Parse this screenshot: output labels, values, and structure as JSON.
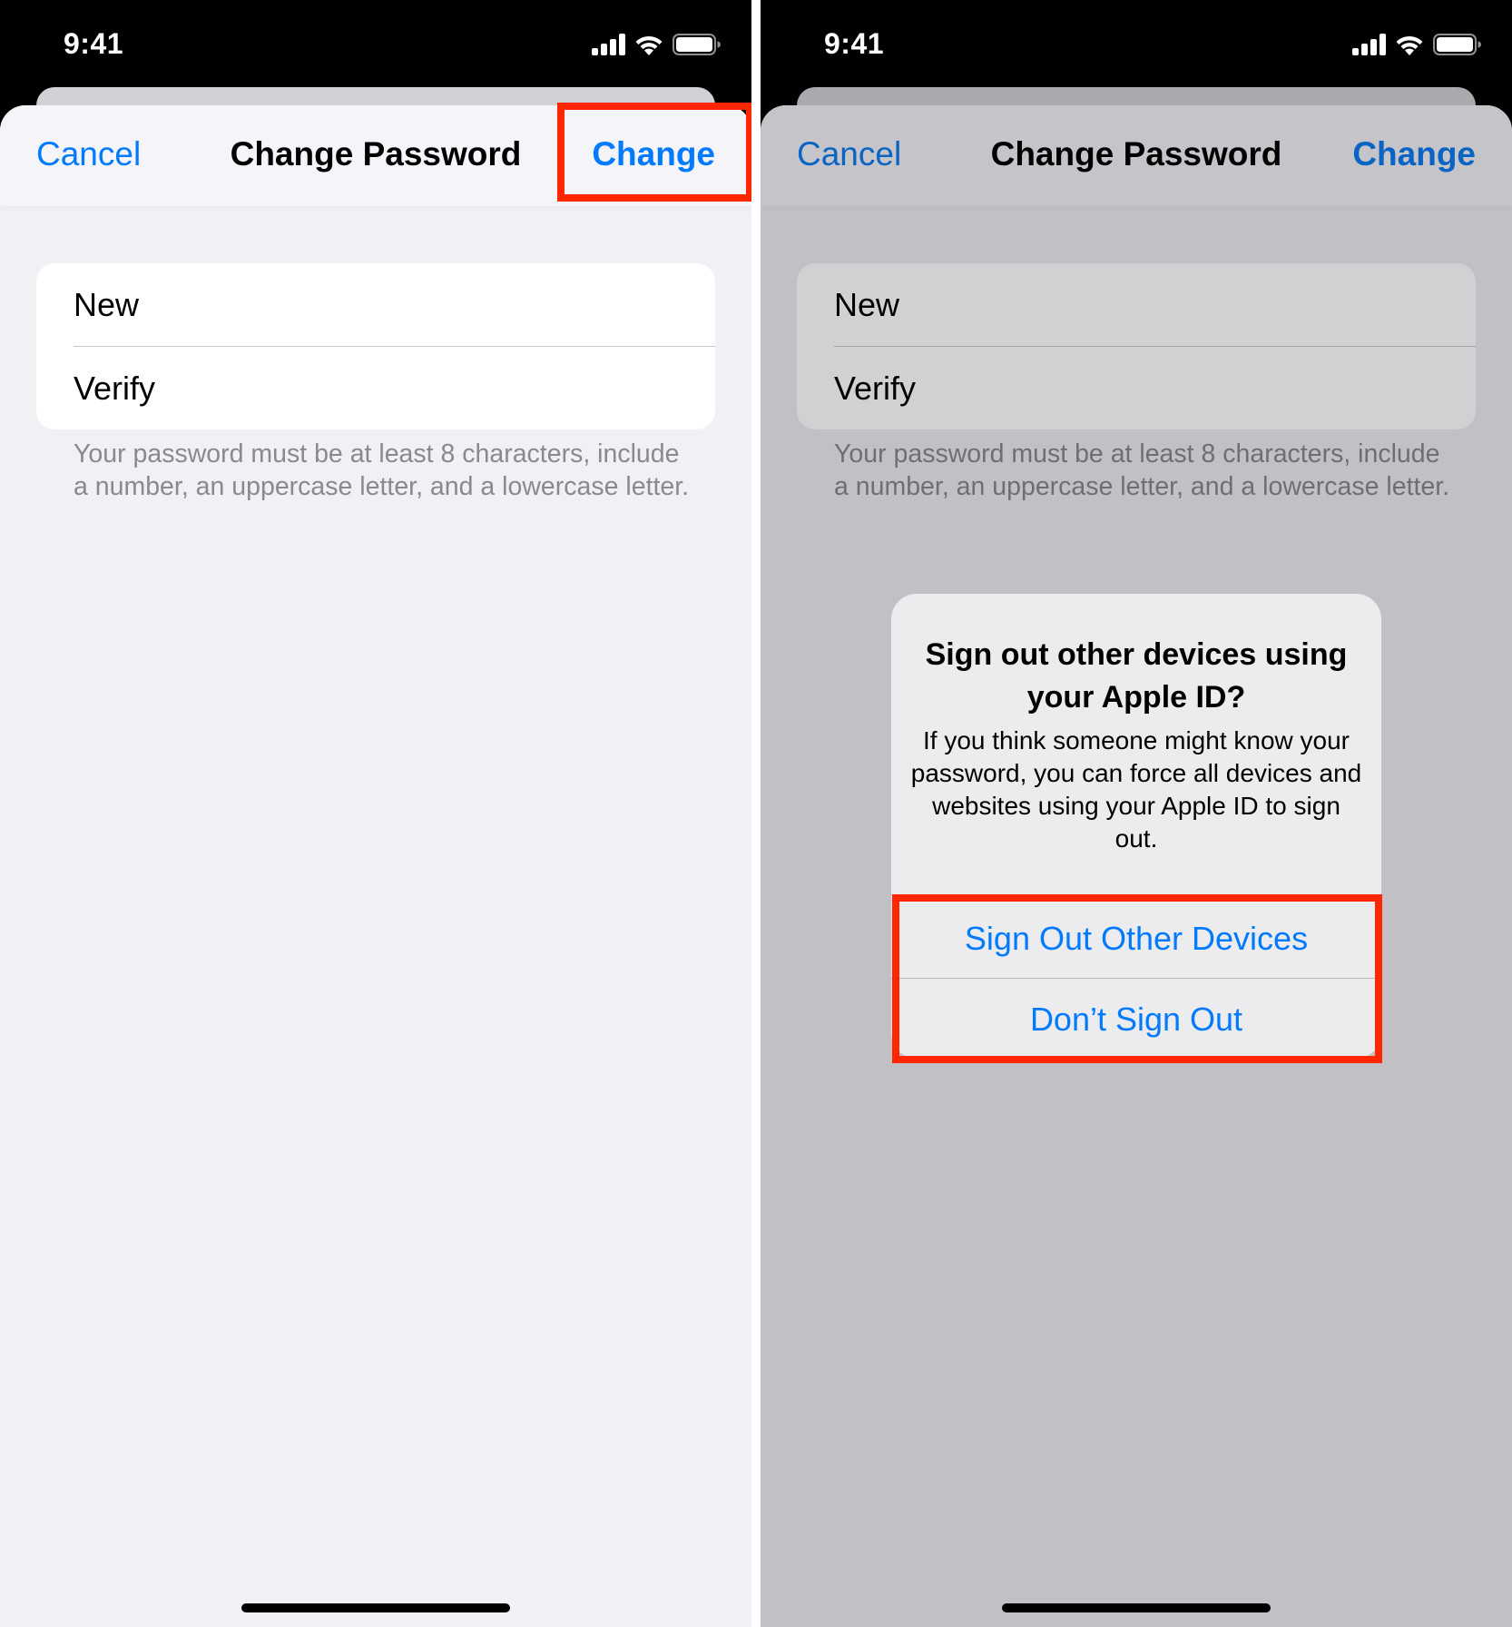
{
  "status_bar": {
    "time": "9:41",
    "icons": [
      "cellular-signal-icon",
      "wifi-icon",
      "battery-icon"
    ]
  },
  "colors": {
    "accent_blue": "#007aff",
    "highlight_red": "#ff2600",
    "background": "#f0f0f5",
    "dimmed_background": "#c1c0c5"
  },
  "screens": [
    {
      "nav": {
        "cancel_label": "Cancel",
        "title": "Change Password",
        "change_label": "Change"
      },
      "form": {
        "fields": [
          {
            "label": "New",
            "value": ""
          },
          {
            "label": "Verify",
            "value": ""
          }
        ],
        "helper_text": "Your password must be at least 8 characters, include a number, an uppercase letter, and a lowercase letter."
      },
      "highlight": "Change"
    },
    {
      "nav": {
        "cancel_label": "Cancel",
        "title": "Change Password",
        "change_label": "Change"
      },
      "form": {
        "fields": [
          {
            "label": "New",
            "value": ""
          },
          {
            "label": "Verify",
            "value": ""
          }
        ],
        "helper_text": "Your password must be at least 8 characters, include a number, an uppercase letter, and a lowercase letter."
      },
      "alert": {
        "title": "Sign out other devices using your Apple ID?",
        "message": "If you think someone might know your password, you can force all devices and websites using your Apple ID to sign out.",
        "buttons": [
          {
            "label": "Sign Out Other Devices"
          },
          {
            "label": "Don’t Sign Out"
          }
        ]
      },
      "highlight": "alert-buttons"
    }
  ]
}
